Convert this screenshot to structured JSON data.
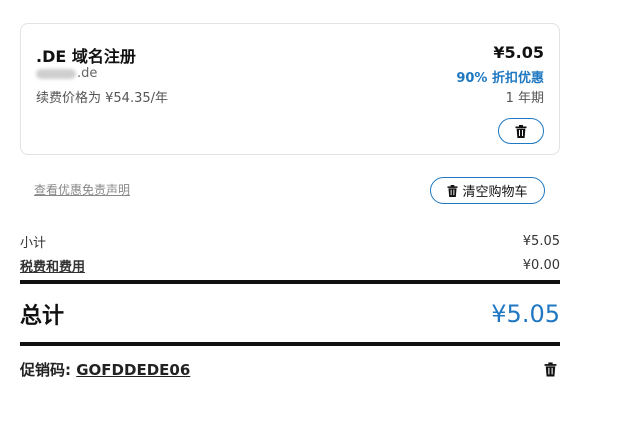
{
  "item": {
    "title": ".DE 域名注册",
    "domain_suffix": ".de",
    "renewal": "续费价格为 ¥54.35/年",
    "price": "¥5.05",
    "discount": "90% 折扣优惠",
    "term": "1 年期",
    "delete_icon": "trash-icon"
  },
  "links": {
    "disclaimer": "查看优惠免责声明",
    "clear_cart": "清空购物车"
  },
  "summary": {
    "subtotal_label": "小计",
    "subtotal_value": "¥5.05",
    "tax_label": "税费和费用",
    "tax_value": "¥0.00",
    "total_label": "总计",
    "total_value": "¥5.05"
  },
  "promo": {
    "label": "促销码:",
    "code": "GOFDDEDE06"
  },
  "colors": {
    "accent": "#1f78c1",
    "text": "#222222",
    "rule": "#111111"
  }
}
